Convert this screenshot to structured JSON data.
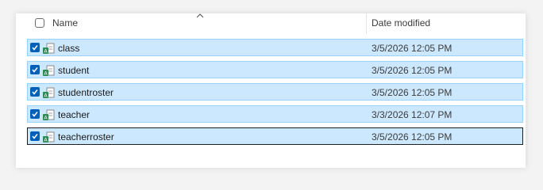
{
  "header": {
    "name_label": "Name",
    "date_label": "Date modified",
    "sort_indicator": "chevron-up-icon"
  },
  "files": [
    {
      "name": "class",
      "date_modified": "3/5/2026 12:05 PM",
      "selected": true,
      "icon": "access-table-icon"
    },
    {
      "name": "student",
      "date_modified": "3/5/2026 12:05 PM",
      "selected": true,
      "icon": "access-table-icon"
    },
    {
      "name": "studentroster",
      "date_modified": "3/5/2026 12:05 PM",
      "selected": true,
      "icon": "access-table-icon"
    },
    {
      "name": "teacher",
      "date_modified": "3/3/2026 12:07 PM",
      "selected": true,
      "icon": "access-table-icon"
    },
    {
      "name": "teacherroster",
      "date_modified": "3/5/2026 12:05 PM",
      "selected": true,
      "focused": true,
      "icon": "access-table-icon"
    }
  ],
  "colors": {
    "selection_bg": "#cce8ff",
    "selection_border": "#99d1ff",
    "checkbox_accent": "#005fb8"
  }
}
